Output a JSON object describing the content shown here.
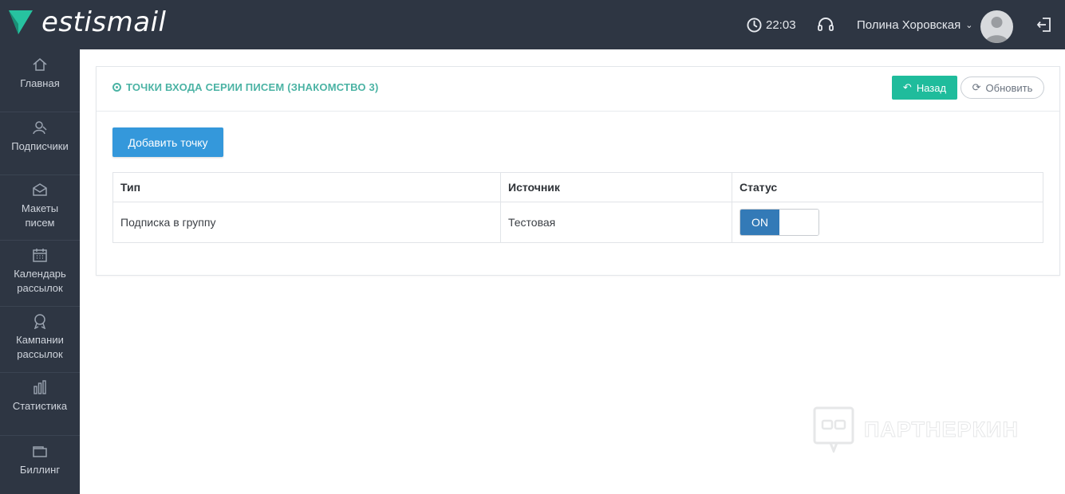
{
  "app": {
    "logo_text": "estismail"
  },
  "header": {
    "time": "22:03",
    "user_name": "Полина Хоровская"
  },
  "sidebar": {
    "items": [
      {
        "label": "Главная",
        "icon": "home-icon"
      },
      {
        "label": "Подписчики",
        "icon": "subscribers-icon"
      },
      {
        "label": "Макеты писем",
        "icon": "envelope-icon"
      },
      {
        "label": "Календарь рассылок",
        "icon": "calendar-icon"
      },
      {
        "label": "Кампании рассылок",
        "icon": "award-icon"
      },
      {
        "label": "Статистика",
        "icon": "bar-chart-icon"
      },
      {
        "label": "Биллинг",
        "icon": "wallet-icon"
      }
    ]
  },
  "panel": {
    "title": "ТОЧКИ ВХОДА СЕРИИ ПИСЕМ (ЗНАКОМСТВО 3)",
    "back_label": "Назад",
    "refresh_label": "Обновить",
    "add_label": "Добавить точку"
  },
  "table": {
    "headers": [
      "Тип",
      "Источник",
      "Статус"
    ],
    "rows": [
      {
        "type": "Подписка в группу",
        "source": "Тестовая",
        "status_label": "ON",
        "status_on": true
      }
    ]
  },
  "watermark": {
    "text": "ПАРТНЕРКИН"
  },
  "colors": {
    "topbar": "#2e3643",
    "accent_green": "#1fbc9c",
    "title_teal": "#4bb3a4",
    "primary_blue": "#3498db",
    "toggle_on": "#337ab7"
  }
}
